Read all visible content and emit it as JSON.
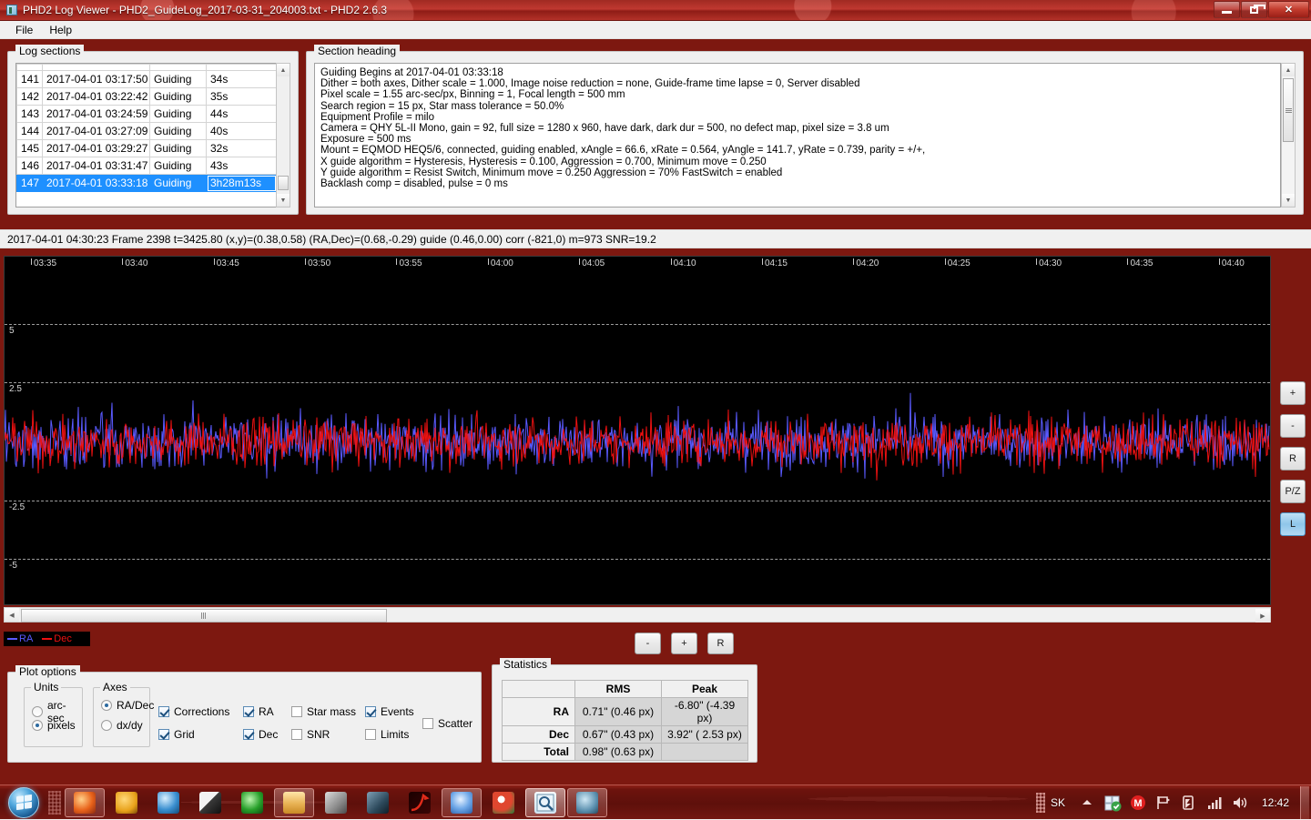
{
  "window": {
    "title": "PHD2 Log Viewer - PHD2_GuideLog_2017-03-31_204003.txt - PHD2 2.6.3",
    "app_icon": "phd2-icon",
    "controls": {
      "minimize": "minimize-button",
      "restore": "restore-button",
      "close": "close-button"
    }
  },
  "menu": {
    "items": [
      {
        "label": "File"
      },
      {
        "label": "Help"
      }
    ]
  },
  "log_sections": {
    "title": "Log sections",
    "rows": [
      {
        "idx": "141",
        "time": "2017-04-01 03:17:50",
        "state": "Guiding",
        "duration": "34s",
        "selected": false
      },
      {
        "idx": "142",
        "time": "2017-04-01 03:22:42",
        "state": "Guiding",
        "duration": "35s",
        "selected": false
      },
      {
        "idx": "143",
        "time": "2017-04-01 03:24:59",
        "state": "Guiding",
        "duration": "44s",
        "selected": false
      },
      {
        "idx": "144",
        "time": "2017-04-01 03:27:09",
        "state": "Guiding",
        "duration": "40s",
        "selected": false
      },
      {
        "idx": "145",
        "time": "2017-04-01 03:29:27",
        "state": "Guiding",
        "duration": "32s",
        "selected": false
      },
      {
        "idx": "146",
        "time": "2017-04-01 03:31:47",
        "state": "Guiding",
        "duration": "43s",
        "selected": false
      },
      {
        "idx": "147",
        "time": "2017-04-01 03:33:18",
        "state": "Guiding",
        "duration": "3h28m13s",
        "selected": true
      }
    ]
  },
  "section_heading": {
    "title": "Section heading",
    "lines": [
      "Guiding Begins at 2017-04-01 03:33:18",
      "Dither = both axes, Dither scale = 1.000, Image noise reduction = none, Guide-frame time lapse = 0, Server disabled",
      "Pixel scale = 1.55 arc-sec/px, Binning = 1, Focal length = 500 mm",
      "Search region = 15 px, Star mass tolerance = 50.0%",
      "Equipment Profile = milo",
      "Camera = QHY 5L-II Mono, gain = 92, full size = 1280 x 960, have dark, dark dur = 500, no defect map, pixel size = 3.8 um",
      "Exposure = 500 ms",
      "Mount = EQMOD HEQ5/6,  connected, guiding enabled, xAngle = 66.6, xRate = 0.564, yAngle = 141.7, yRate = 0.739, parity = +/+,",
      "X guide algorithm = Hysteresis, Hysteresis = 0.100, Aggression = 0.700, Minimum move = 0.250",
      "Y guide algorithm = Resist Switch, Minimum move = 0.250 Aggression = 70% FastSwitch = enabled",
      "Backlash comp = disabled, pulse = 0 ms"
    ]
  },
  "status_line": {
    "text": "2017-04-01 04:30:23 Frame 2398 t=3425.80 (x,y)=(0.38,0.58) (RA,Dec)=(0.68,-0.29) guide (0.46,0.00) corr (-821,0) m=973 SNR=19.2"
  },
  "chart_data": {
    "type": "line",
    "title": "",
    "xlabel": "",
    "ylabel": "",
    "background": "#000000",
    "grid": true,
    "grid_style": "dashed",
    "grid_color": "#b8b8b8",
    "legend_position": "bottom-left",
    "x_tick_labels": [
      "03:35",
      "03:40",
      "03:45",
      "03:50",
      "03:55",
      "04:00",
      "04:05",
      "04:10",
      "04:15",
      "04:20",
      "04:25",
      "04:30",
      "04:35",
      "04:40"
    ],
    "y_tick_labels": [
      "5",
      "2.5",
      "-2.5",
      "-5"
    ],
    "y_tick_values": [
      5,
      2.5,
      -2.5,
      -5
    ],
    "ylim": [
      -7,
      7
    ],
    "units": "pixels",
    "series": [
      {
        "name": "RA",
        "color": "#5a5aff",
        "rms": 0.46,
        "peak": -4.39
      },
      {
        "name": "Dec",
        "color": "#ee1111",
        "rms": 0.43,
        "peak": 2.53
      }
    ]
  },
  "legend": {
    "entries": [
      {
        "label": "RA",
        "color": "#5a5aff"
      },
      {
        "label": "Dec",
        "color": "#ee1111"
      }
    ]
  },
  "right_buttons": [
    {
      "label": "+",
      "name": "zoom-in-button",
      "active": false
    },
    {
      "label": "-",
      "name": "zoom-out-button",
      "active": false
    },
    {
      "label": "R",
      "name": "reset-button",
      "active": false
    },
    {
      "label": "P/Z",
      "name": "pan-zoom-button",
      "active": false
    },
    {
      "label": "L",
      "name": "lock-button",
      "active": true
    }
  ],
  "center_buttons": [
    {
      "label": "-",
      "name": "hscale-down-button"
    },
    {
      "label": "+",
      "name": "hscale-up-button"
    },
    {
      "label": "R",
      "name": "hscale-reset-button"
    }
  ],
  "plot_options": {
    "title": "Plot options",
    "units": {
      "title": "Units",
      "options": [
        {
          "label": "arc-sec",
          "selected": false
        },
        {
          "label": "pixels",
          "selected": true
        }
      ]
    },
    "axes": {
      "title": "Axes",
      "options": [
        {
          "label": "RA/Dec",
          "selected": true
        },
        {
          "label": "dx/dy",
          "selected": false
        }
      ]
    },
    "checkboxes": [
      {
        "label": "Corrections",
        "checked": true
      },
      {
        "label": "Grid",
        "checked": true
      },
      {
        "label": "RA",
        "checked": true
      },
      {
        "label": "Dec",
        "checked": true
      },
      {
        "label": "Star mass",
        "checked": false
      },
      {
        "label": "SNR",
        "checked": false
      },
      {
        "label": "Events",
        "checked": true
      },
      {
        "label": "Limits",
        "checked": false
      },
      {
        "label": "Scatter",
        "checked": false
      }
    ]
  },
  "statistics": {
    "title": "Statistics",
    "columns": [
      "",
      "RMS",
      "Peak"
    ],
    "rows": [
      {
        "label": "RA",
        "rms": "0.71\" (0.46 px)",
        "peak": "-6.80\" (-4.39 px)"
      },
      {
        "label": "Dec",
        "rms": "0.67\" (0.43 px)",
        "peak": "3.92\" ( 2.53 px)"
      },
      {
        "label": "Total",
        "rms": "0.98\" (0.63 px)",
        "peak": ""
      }
    ]
  },
  "taskbar": {
    "start": "start-orb",
    "apps": [
      {
        "name": "firefox-icon",
        "open": true
      },
      {
        "name": "thunderbird-icon",
        "open": false
      },
      {
        "name": "browser-icon",
        "open": false
      },
      {
        "name": "image-viewer-icon",
        "open": false
      },
      {
        "name": "green-app-icon",
        "open": false
      },
      {
        "name": "file-explorer-icon",
        "open": true
      },
      {
        "name": "media-icon",
        "open": false
      },
      {
        "name": "photo-app-icon",
        "open": false
      },
      {
        "name": "curve-app-icon",
        "open": false
      },
      {
        "name": "diamond-app-icon",
        "open": true
      },
      {
        "name": "chrome-icon",
        "open": false
      },
      {
        "name": "phd2-logviewer-icon",
        "open": true,
        "active": true
      },
      {
        "name": "phd2-icon",
        "open": true
      }
    ],
    "tray": {
      "language": "SK",
      "icons": [
        "show-hidden-icon",
        "update-icon",
        "mail-icon",
        "flag-icon",
        "power-icon",
        "network-icon",
        "volume-icon"
      ],
      "clock": "12:42"
    }
  }
}
